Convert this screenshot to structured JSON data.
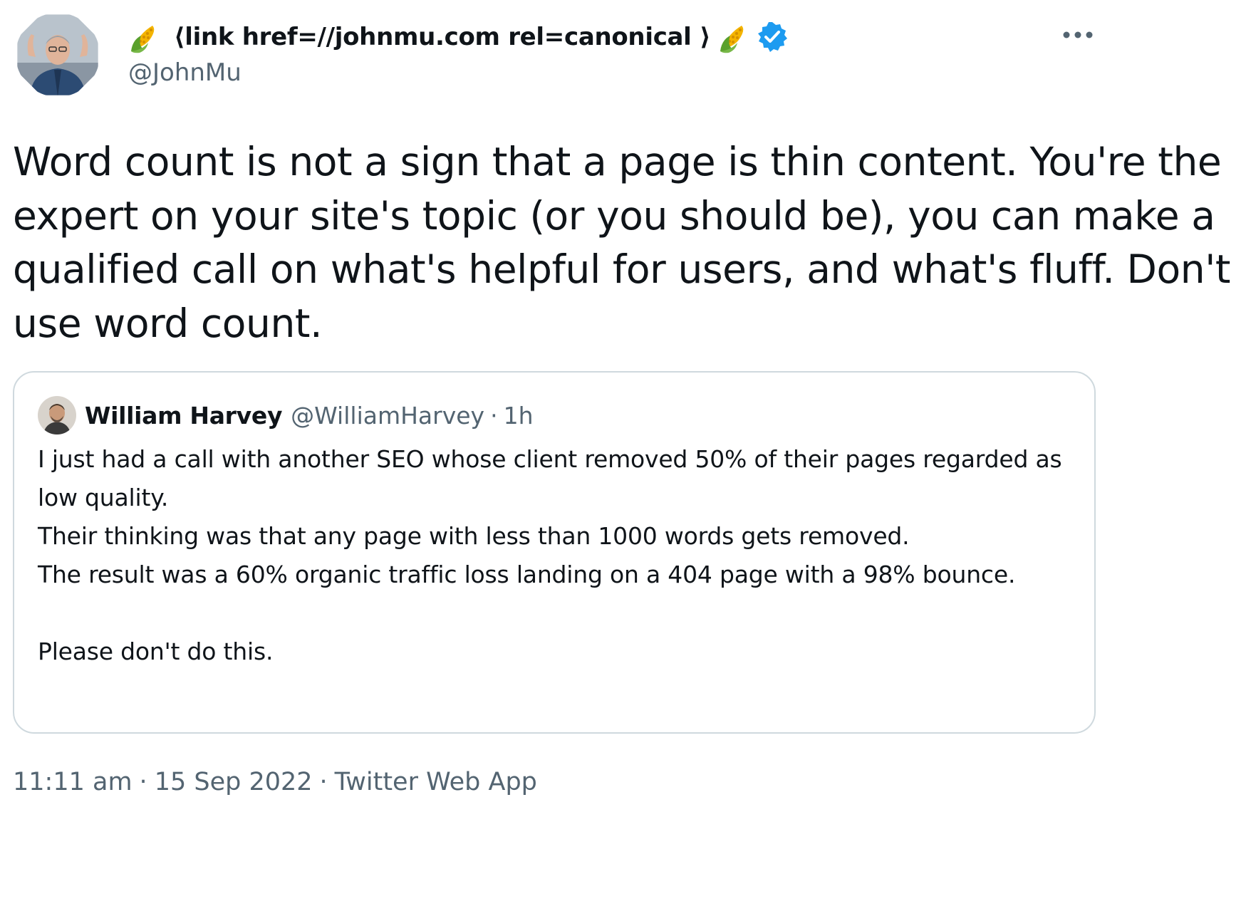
{
  "author": {
    "display_name": "⟨link href=//johnmu.com rel=canonical ⟩",
    "handle": "@JohnMu",
    "verified": true,
    "name_emoji_icon": "corn-icon"
  },
  "tweet": {
    "text": "Word count is not a sign that a page is thin content. You're the expert on your site's topic (or you should be), you can make a qualified call on what's helpful for users, and what's fluff. Don't use word count."
  },
  "quoted_tweet": {
    "author_name": "William Harvey",
    "author_handle": "@WilliamHarvey",
    "separator": "·",
    "time_ago": "1h",
    "lines": [
      "I just had a call with another SEO whose client removed 50% of their pages regarded as low quality.",
      "Their thinking was that any page with less than 1000 words gets removed.",
      "The result was a 60% organic traffic loss landing on a 404 page with a 98% bounce.",
      "Please don't do this."
    ]
  },
  "meta": {
    "time": "11:11 am",
    "date": "15 Sep 2022",
    "source": "Twitter Web App",
    "separator": "·"
  },
  "colors": {
    "text_primary": "#0f1419",
    "text_secondary": "#536471",
    "verified_blue": "#1d9bf0",
    "card_border": "#cfd9de"
  }
}
